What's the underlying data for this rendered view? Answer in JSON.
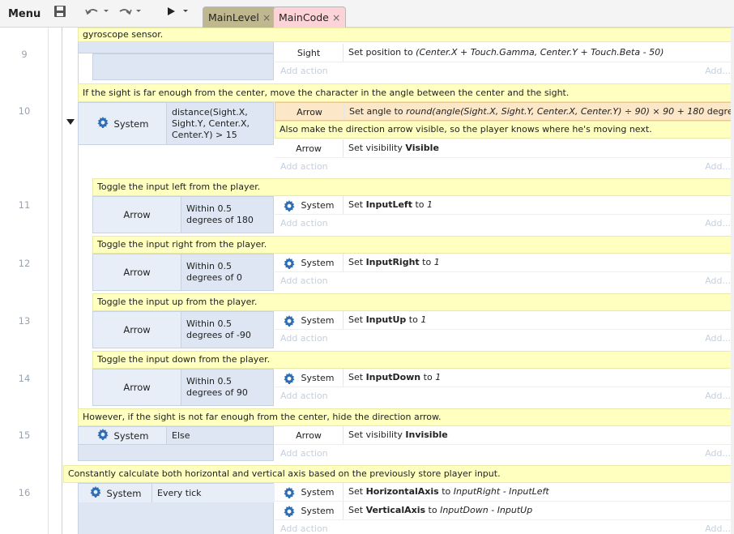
{
  "toolbar": {
    "menu_label": "Menu",
    "save_icon": "save-icon",
    "undo_icon": "undo-icon",
    "redo_icon": "redo-icon",
    "play_icon": "play-icon"
  },
  "tabs": [
    {
      "label": "MainLevel",
      "close": "×"
    },
    {
      "label": "MainCode",
      "close": "×"
    }
  ],
  "line_numbers": [
    "9",
    "10",
    "11",
    "12",
    "13",
    "14",
    "15",
    "16"
  ],
  "rows": {
    "r9": {
      "comment_tail": "gyroscope sensor.",
      "action_obj": "Sight",
      "action_prefix": "Set position to ",
      "action_italic": "(Center.X + Touch.Gamma, Center.Y + Touch.Beta - 50)",
      "add_action": "Add action",
      "add_short": "Add..."
    },
    "r10": {
      "comment": "If the sight is far enough from the center, move the character in the angle between the center and the sight.",
      "cond_obj": "System",
      "cond_text": "distance(Sight.X, Sight.Y, Center.X, Center.Y) > 15",
      "act1_obj": "Arrow",
      "act1_prefix": "Set angle to ",
      "act1_italic": "round(angle(Sight.X, Sight.Y, Center.X, Center.Y) ÷ 90) × 90 + 180",
      "act1_suffix": " degrees",
      "inner_comment": "Also make the direction arrow visible, so the player knows where he's moving next.",
      "act2_obj": "Arrow",
      "act2_prefix": "Set visibility ",
      "act2_bold": "Visible",
      "add_action": "Add action",
      "add_short": "Add..."
    },
    "r11": {
      "comment": "Toggle the input left from the player.",
      "cond_obj": "Arrow",
      "cond_text": "Within 0.5 degrees of 180",
      "act_obj": "System",
      "act_prefix": "Set ",
      "act_bold": "InputLeft",
      "act_mid": " to ",
      "act_italic": "1",
      "add_action": "Add action",
      "add_short": "Add..."
    },
    "r12": {
      "comment": "Toggle the input right from the player.",
      "cond_obj": "Arrow",
      "cond_text": "Within 0.5 degrees of 0",
      "act_obj": "System",
      "act_prefix": "Set ",
      "act_bold": "InputRight",
      "act_mid": " to ",
      "act_italic": "1",
      "add_action": "Add action",
      "add_short": "Add..."
    },
    "r13": {
      "comment": "Toggle the input up from the player.",
      "cond_obj": "Arrow",
      "cond_text": "Within 0.5 degrees of -90",
      "act_obj": "System",
      "act_prefix": "Set ",
      "act_bold": "InputUp",
      "act_mid": " to ",
      "act_italic": "1",
      "add_action": "Add action",
      "add_short": "Add..."
    },
    "r14": {
      "comment": "Toggle the input down from the player.",
      "cond_obj": "Arrow",
      "cond_text": "Within 0.5 degrees of 90",
      "act_obj": "System",
      "act_prefix": "Set ",
      "act_bold": "InputDown",
      "act_mid": " to ",
      "act_italic": "1",
      "add_action": "Add action",
      "add_short": "Add..."
    },
    "r15": {
      "comment": "However, if the sight is not far enough from the center, hide the direction arrow.",
      "cond_obj": "System",
      "cond_text": "Else",
      "act_obj": "Arrow",
      "act_prefix": "Set visibility ",
      "act_bold": "Invisible",
      "add_action": "Add action",
      "add_short": "Add..."
    },
    "r16": {
      "comment": "Constantly calculate both horizontal and vertical axis based on the previously store player input.",
      "cond_obj": "System",
      "cond_text": "Every tick",
      "act1_obj": "System",
      "act1_prefix": "Set ",
      "act1_bold": "HorizontalAxis",
      "act1_mid": " to ",
      "act1_italic": "InputRight - InputLeft",
      "act2_obj": "System",
      "act2_prefix": "Set ",
      "act2_bold": "VerticalAxis",
      "act2_mid": " to ",
      "act2_italic": "InputDown - InputUp",
      "add_action": "Add action",
      "add_short": "Add..."
    }
  },
  "colors": {
    "comment_bg": "#ffffc0",
    "condition_bg": "#dde6f2",
    "action_highlight": "#fce7c8",
    "tab_level": "#bfb78e",
    "tab_code": "#fdd3d8",
    "gear": "#2f6db5"
  }
}
